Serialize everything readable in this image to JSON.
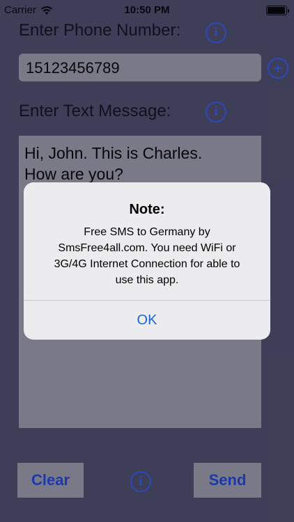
{
  "status_bar": {
    "carrier": "Carrier",
    "time": "10:50 PM"
  },
  "form": {
    "phone_label": "Enter Phone Number:",
    "phone_value": "15123456789",
    "message_label": "Enter Text Message:",
    "message_value": "Hi, John. This is Charles.\nHow are you?",
    "info_icon_glyph": "i",
    "add_icon_glyph": "+"
  },
  "buttons": {
    "clear": "Clear",
    "send": "Send"
  },
  "alert": {
    "title": "Note:",
    "message": "Free SMS to Germany by SmsFree4all.com.  You need WiFi or 3G/4G Internet Connection for able to use this app.",
    "ok": "OK"
  },
  "colors": {
    "background": "#45445e",
    "field": "#8d8c98",
    "accent": "#2a52d8"
  }
}
